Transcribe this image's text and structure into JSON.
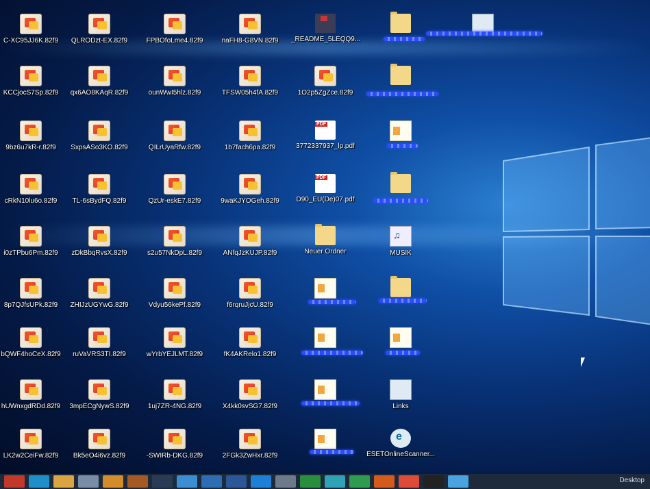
{
  "desktop": {
    "icons": [
      {
        "label": "C-XC95JJ6K.82f9",
        "type": "enc"
      },
      {
        "label": "QLRODzt-EX.82f9",
        "type": "enc"
      },
      {
        "label": "FPBOfoLme4.82f9",
        "type": "enc"
      },
      {
        "label": "naFH8-G8VN.82f9",
        "type": "enc"
      },
      {
        "label": "_README_5LEQQ9...",
        "type": "readme"
      },
      {
        "label": "",
        "type": "folder"
      },
      {
        "label": "",
        "type": "shortcut"
      },
      {
        "label": "KCCjocS7Sp.82f9",
        "type": "enc"
      },
      {
        "label": "qx6AO8KAqR.82f9",
        "type": "enc"
      },
      {
        "label": "ounWwI5hlz.82f9",
        "type": "enc"
      },
      {
        "label": "TFSW05h4fA.82f9",
        "type": "enc"
      },
      {
        "label": "1O2p5ZgZce.82f9",
        "type": "enc"
      },
      {
        "label": "",
        "type": "folder"
      },
      {
        "label": "9bz6u7kR-r.82f9",
        "type": "enc"
      },
      {
        "label": "SxpsASo3KO.82f9",
        "type": "enc"
      },
      {
        "label": "QILrUyaRfw.82f9",
        "type": "enc"
      },
      {
        "label": "1b7fach6pa.82f9",
        "type": "enc"
      },
      {
        "label": "3772337937_lp.pdf",
        "type": "pdf"
      },
      {
        "label": "",
        "type": "doc"
      },
      {
        "label": "cRkN10lu6o.82f9",
        "type": "enc"
      },
      {
        "label": "TL-6sBydFQ.82f9",
        "type": "enc"
      },
      {
        "label": "QzUr-eskE7.82f9",
        "type": "enc"
      },
      {
        "label": "9waKJYOGeh.82f9",
        "type": "enc"
      },
      {
        "label": "D90_EU(De)07.pdf",
        "type": "pdf"
      },
      {
        "label": "",
        "type": "folder"
      },
      {
        "label": "i0zTPbu6Pm.82f9",
        "type": "enc"
      },
      {
        "label": "zDkBbqRvsX.82f9",
        "type": "enc"
      },
      {
        "label": "s2u57NkDpL.82f9",
        "type": "enc"
      },
      {
        "label": "ANfqJzKUJP.82f9",
        "type": "enc"
      },
      {
        "label": "Neuer Ordner",
        "type": "folder"
      },
      {
        "label": "MUSIK",
        "type": "music"
      },
      {
        "label": "8p7QJfsUPk.82f9",
        "type": "enc"
      },
      {
        "label": "ZHIJzUGYwG.82f9",
        "type": "enc"
      },
      {
        "label": "Vdyu56kePf.82f9",
        "type": "enc"
      },
      {
        "label": "f6rqruJjcU.82f9",
        "type": "enc"
      },
      {
        "label": "",
        "type": "doc"
      },
      {
        "label": "",
        "type": "folder"
      },
      {
        "label": "bQWF4hoCeX.82f9",
        "type": "enc"
      },
      {
        "label": "ruVaVRS3TI.82f9",
        "type": "enc"
      },
      {
        "label": "wYrbYEJLMT.82f9",
        "type": "enc"
      },
      {
        "label": "fK4AKRelo1.82f9",
        "type": "enc"
      },
      {
        "label": "",
        "type": "doc"
      },
      {
        "label": "",
        "type": "doc"
      },
      {
        "label": "hUWnxgdRDd.82f9",
        "type": "enc"
      },
      {
        "label": "3mpECgNywS.82f9",
        "type": "enc"
      },
      {
        "label": "1uj7ZR-4NG.82f9",
        "type": "enc"
      },
      {
        "label": "X4kk0svSG7.82f9",
        "type": "enc"
      },
      {
        "label": "",
        "type": "doc"
      },
      {
        "label": "Links",
        "type": "shortcut"
      },
      {
        "label": "LK2w2CeiFw.82f9",
        "type": "enc"
      },
      {
        "label": "Bk5eO4i6vz.82f9",
        "type": "enc"
      },
      {
        "label": "-SWIRb-DKG.82f9",
        "type": "enc"
      },
      {
        "label": "2FGk3ZwHxr.82f9",
        "type": "enc"
      },
      {
        "label": "",
        "type": "doc"
      },
      {
        "label": "ESETOnlineScanner...",
        "type": "eset"
      }
    ]
  },
  "taskbar": {
    "desktop_label": "Desktop",
    "items": [
      {
        "icon": "start-icon",
        "color": "#c0392b"
      },
      {
        "icon": "search-icon",
        "color": "#1f8fc9"
      },
      {
        "icon": "file-explorer-icon",
        "color": "#d9a441"
      },
      {
        "icon": "store-icon",
        "color": "#7a8da6"
      },
      {
        "icon": "app-icon",
        "color": "#d38c2c"
      },
      {
        "icon": "app-icon",
        "color": "#a45a22"
      },
      {
        "icon": "app-icon",
        "color": "#2a3b55"
      },
      {
        "icon": "network-icon",
        "color": "#3b8ed1"
      },
      {
        "icon": "email-icon",
        "color": "#2d6db4"
      },
      {
        "icon": "word-icon",
        "color": "#2b5797"
      },
      {
        "icon": "edge-icon",
        "color": "#1e7fd6"
      },
      {
        "icon": "clock-icon",
        "color": "#6d7a8a"
      },
      {
        "icon": "download-icon",
        "color": "#2a8e3f"
      },
      {
        "icon": "security-icon",
        "color": "#2fa3b5"
      },
      {
        "icon": "settings-icon",
        "color": "#2e9b50"
      },
      {
        "icon": "office-icon",
        "color": "#d55a1e"
      },
      {
        "icon": "chrome-icon",
        "color": "#dd4b39"
      },
      {
        "icon": "eye-icon",
        "color": "#222"
      },
      {
        "icon": "photos-icon",
        "color": "#4aa3df"
      }
    ]
  }
}
